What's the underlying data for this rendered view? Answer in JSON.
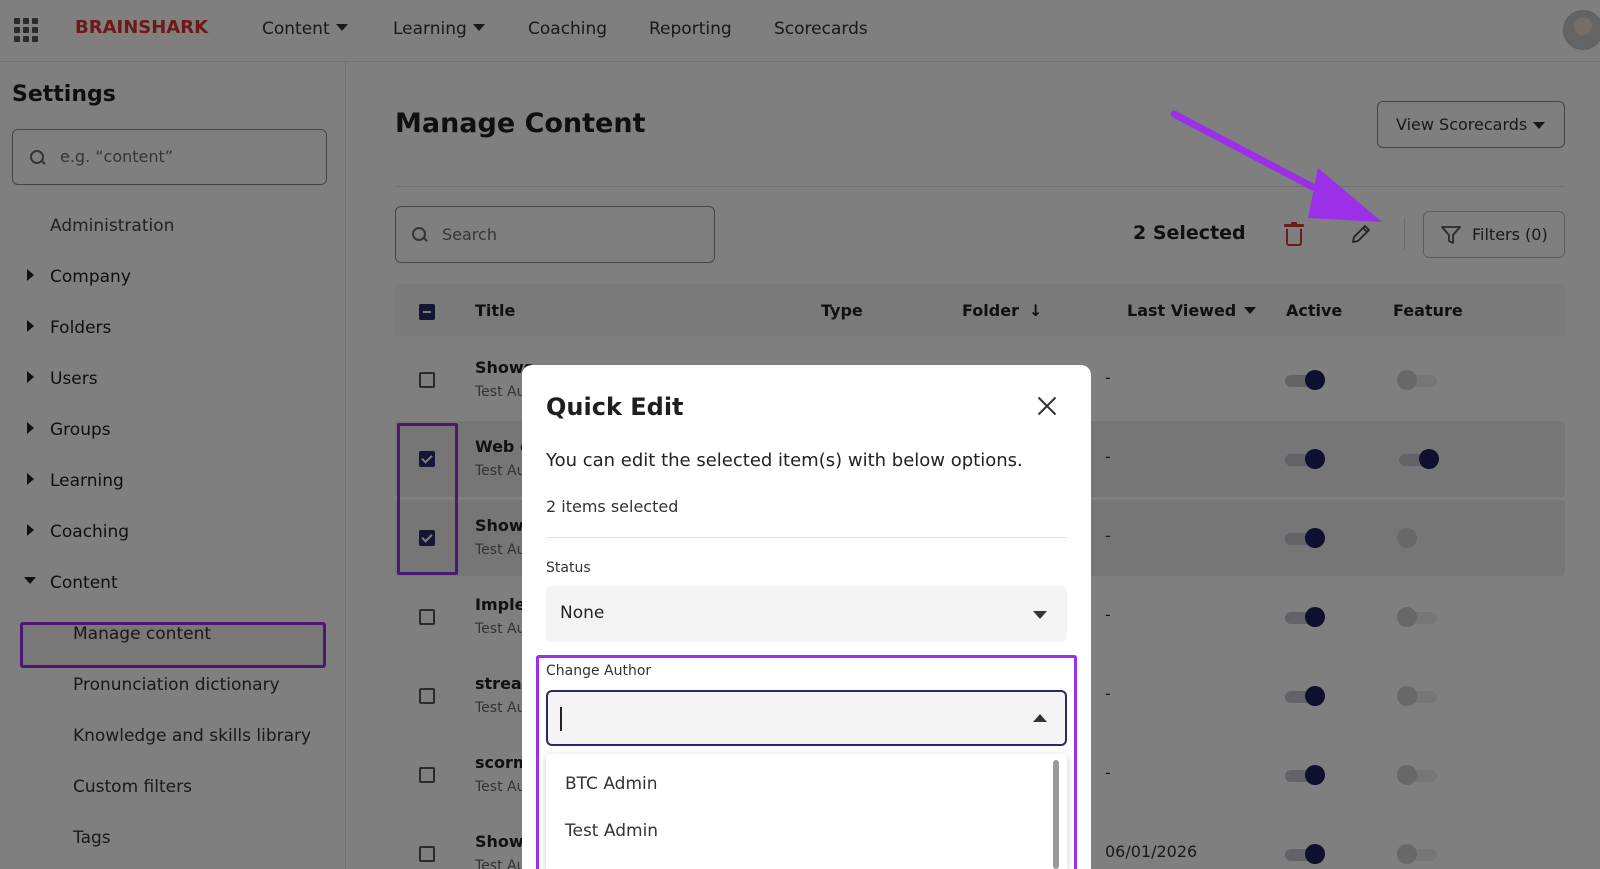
{
  "topbar": {
    "logo": "BRAINSHARK",
    "nav": [
      "Content",
      "Learning",
      "Coaching",
      "Reporting",
      "Scorecards"
    ]
  },
  "sidebar": {
    "title": "Settings",
    "search_placeholder": "e.g. “content”",
    "items": {
      "administration": "Administration",
      "company": "Company",
      "folders": "Folders",
      "users": "Users",
      "groups": "Groups",
      "learning": "Learning",
      "coaching": "Coaching",
      "content": "Content"
    },
    "content_sub": [
      "Manage content",
      "Pronunciation dictionary",
      "Knowledge and skills library",
      "Custom filters",
      "Tags"
    ]
  },
  "main": {
    "title": "Manage Content",
    "view_scorecards": "View Scorecards",
    "search_placeholder": "Search",
    "selected_label": "2  Selected",
    "filters_label": "Filters (0)",
    "columns": [
      "Title",
      "Type",
      "Folder",
      "Last Viewed",
      "Active",
      "Feature"
    ],
    "rows": [
      {
        "title": "Shows",
        "sub": "Test Au",
        "date": "-",
        "checked": false,
        "active": true,
        "feature": false
      },
      {
        "title": "Web c",
        "sub": "Test Au",
        "date": "-",
        "checked": true,
        "active": true,
        "feature": true
      },
      {
        "title": "Shows",
        "sub": "Test Au",
        "date": "-",
        "checked": true,
        "active": true,
        "feature": false
      },
      {
        "title": "Imple",
        "sub": "Test Au",
        "date": "-",
        "checked": false,
        "active": true,
        "feature": false
      },
      {
        "title": "strear",
        "sub": "Test Au",
        "date": "-",
        "checked": false,
        "active": true,
        "feature": false
      },
      {
        "title": "scorm",
        "sub": "Test Au",
        "date": "-",
        "checked": false,
        "active": true,
        "feature": false
      },
      {
        "title": "Showp",
        "sub": "Test Au",
        "date": "06/01/2026",
        "checked": false,
        "active": true,
        "feature": false
      }
    ]
  },
  "modal": {
    "title": "Quick Edit",
    "description": "You can edit the selected item(s) with below options.",
    "count": "2 items selected",
    "status_label": "Status",
    "status_value": "None",
    "author_label": "Change Author",
    "author_options": [
      "BTC Admin",
      "Test Admin"
    ]
  },
  "colors": {
    "accent": "#9b30e8",
    "brand": "#e03030",
    "primary": "#1e1e5e",
    "danger": "#d23b3b"
  }
}
